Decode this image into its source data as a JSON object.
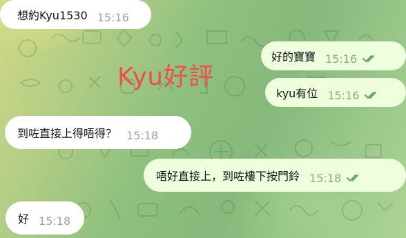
{
  "chat": {
    "watermark": "Kyu好評",
    "messages": [
      {
        "direction": "incoming",
        "text": "想約Kyu1530",
        "time": "15:16",
        "read": false
      },
      {
        "direction": "outgoing",
        "text": "好的寶寶",
        "time": "15:16",
        "read": true
      },
      {
        "direction": "outgoing",
        "text": "kyu有位",
        "time": "15:16",
        "read": true
      },
      {
        "direction": "incoming",
        "text": "到咗直接上得唔得？",
        "time": "15:18",
        "read": false
      },
      {
        "direction": "outgoing",
        "text": "唔好直接上，到咗樓下按門鈴",
        "time": "15:18",
        "read": true
      },
      {
        "direction": "incoming",
        "text": "好",
        "time": "15:18",
        "read": false
      }
    ]
  },
  "icons": {
    "read_receipt": "double-check-icon",
    "background": "doodle-pattern-icon"
  },
  "colors": {
    "incoming_bubble": "#ffffff",
    "outgoing_bubble": "#efffde",
    "outgoing_meta": "#7fb07a",
    "incoming_meta": "#9aa4ad",
    "watermark": "#f04d4d"
  }
}
